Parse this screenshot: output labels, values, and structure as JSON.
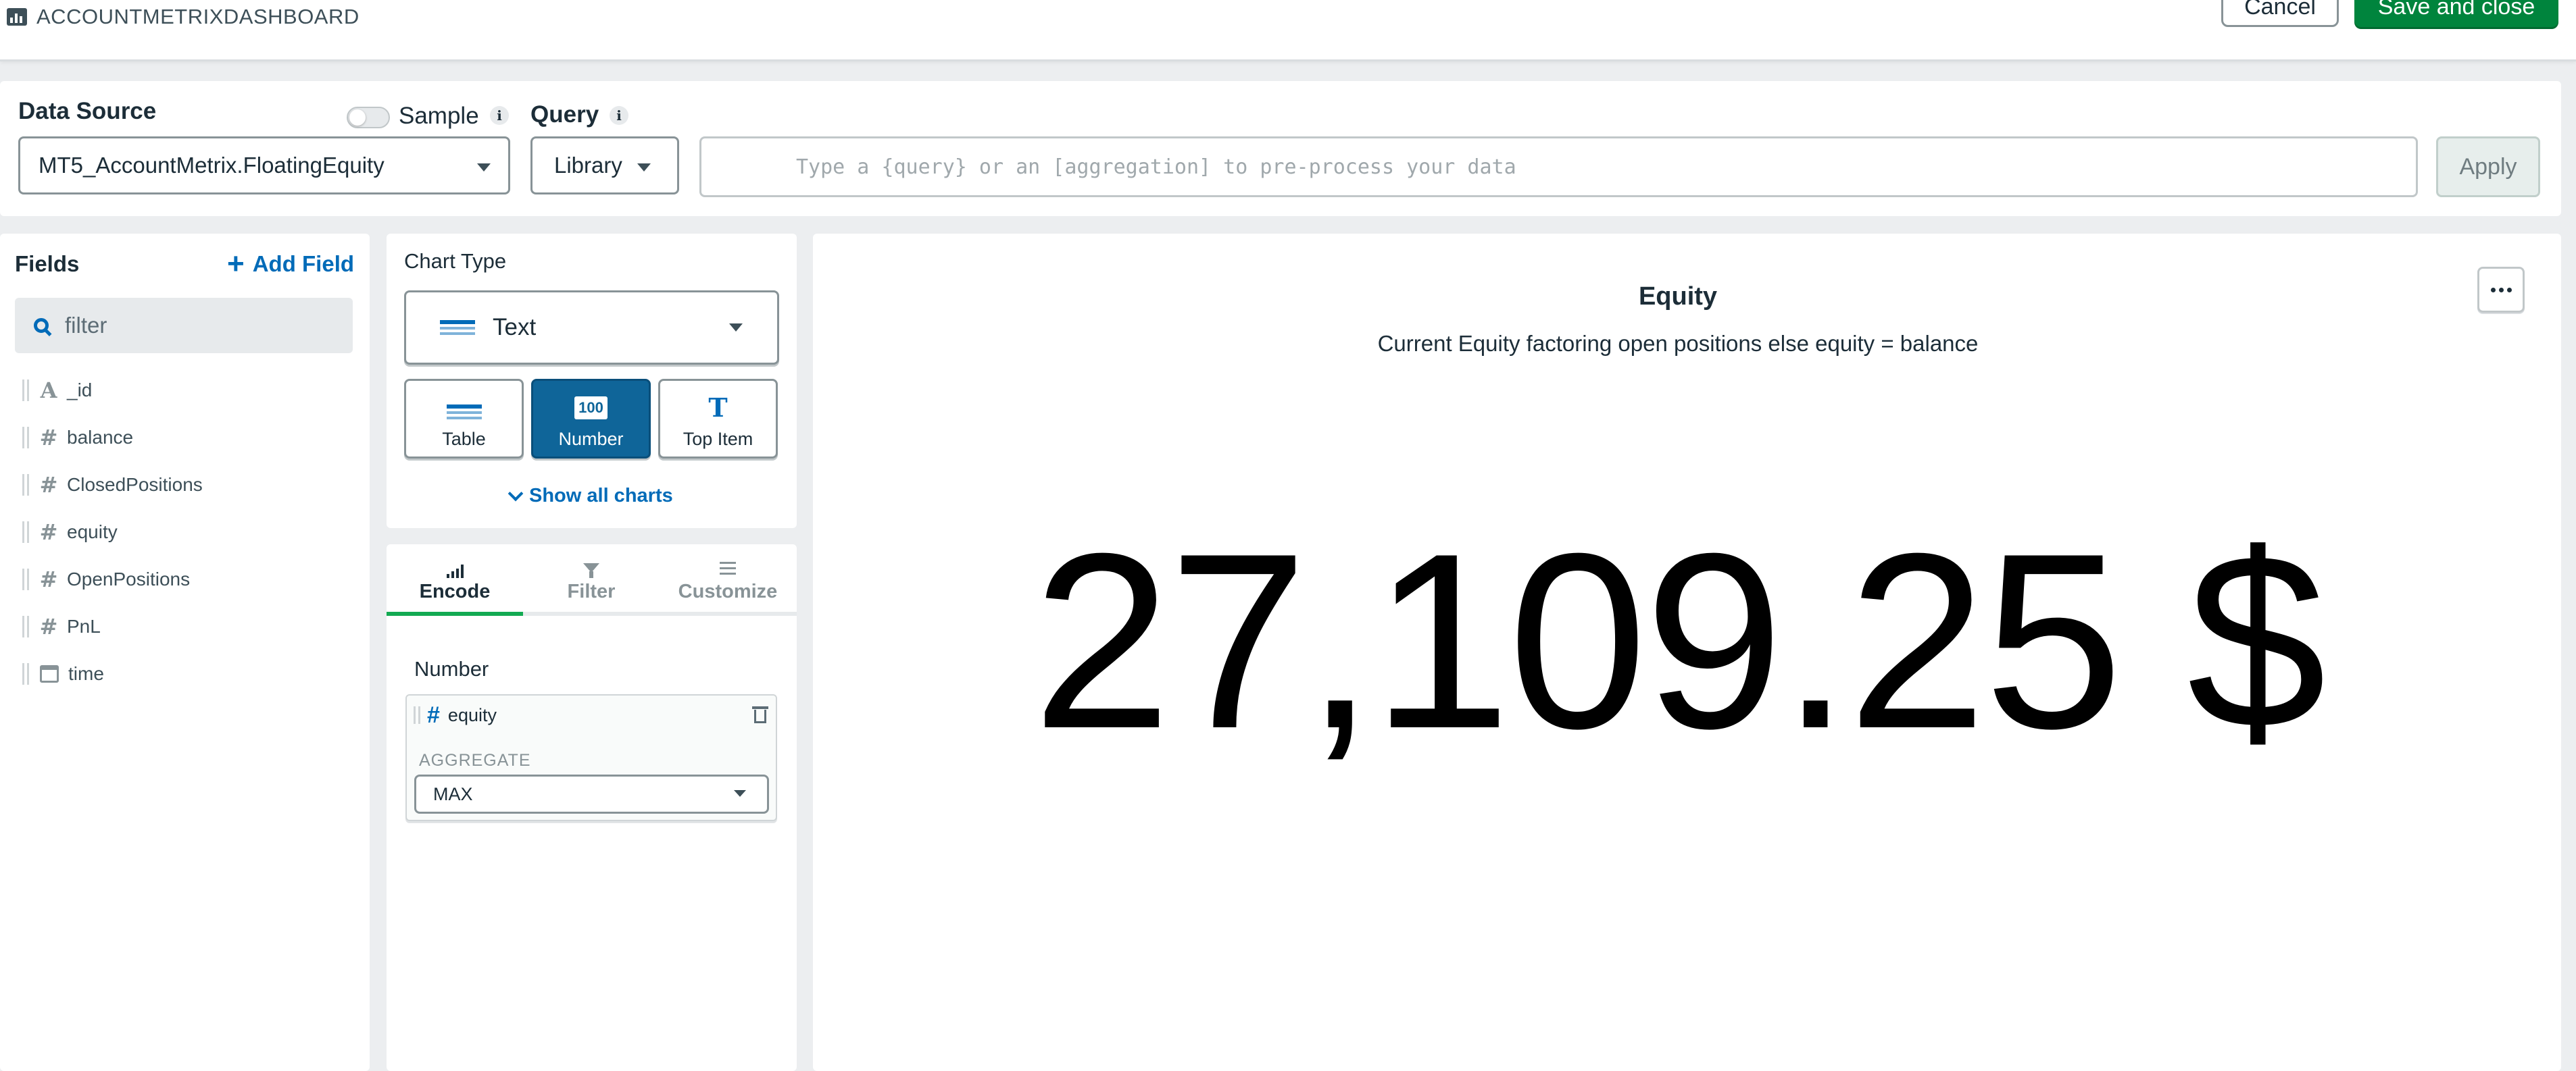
{
  "header": {
    "app_title": "ACCOUNTMETRIXDASHBOARD",
    "cancel_label": "Cancel",
    "save_label": "Save and close"
  },
  "datasource": {
    "label": "Data Source",
    "sample_label": "Sample",
    "sample_enabled": false,
    "selected": "MT5_AccountMetrix.FloatingEquity",
    "query_label": "Query",
    "query_mode": "Library",
    "query_placeholder": "Type a {query} or an [aggregation] to pre-process your data",
    "apply_label": "Apply"
  },
  "fields": {
    "title": "Fields",
    "add_label": "Add Field",
    "filter_placeholder": "filter",
    "items": [
      {
        "name": "_id",
        "type": "string"
      },
      {
        "name": "balance",
        "type": "number"
      },
      {
        "name": "ClosedPositions",
        "type": "number"
      },
      {
        "name": "equity",
        "type": "number"
      },
      {
        "name": "OpenPositions",
        "type": "number"
      },
      {
        "name": "PnL",
        "type": "number"
      },
      {
        "name": "time",
        "type": "date"
      }
    ]
  },
  "chart_type": {
    "title": "Chart Type",
    "selected": "Text",
    "options": [
      {
        "label": "Table",
        "active": false
      },
      {
        "label": "Number",
        "active": true,
        "icon_text": "100"
      },
      {
        "label": "Top Item",
        "active": false
      }
    ],
    "show_all_label": "Show all charts"
  },
  "encode": {
    "tabs": [
      {
        "label": "Encode",
        "active": true
      },
      {
        "label": "Filter",
        "active": false
      },
      {
        "label": "Customize",
        "active": false
      }
    ],
    "channel_label": "Number",
    "field": "equity",
    "aggregate_label": "AGGREGATE",
    "aggregate_value": "MAX"
  },
  "chart": {
    "title": "Equity",
    "description": "Current Equity factoring open positions else equity = balance",
    "value": "27,109.25 $"
  },
  "colors": {
    "accent": "#016bb8",
    "save": "#00843d",
    "active_type": "#0f6599",
    "tab_underline": "#13aa52"
  }
}
